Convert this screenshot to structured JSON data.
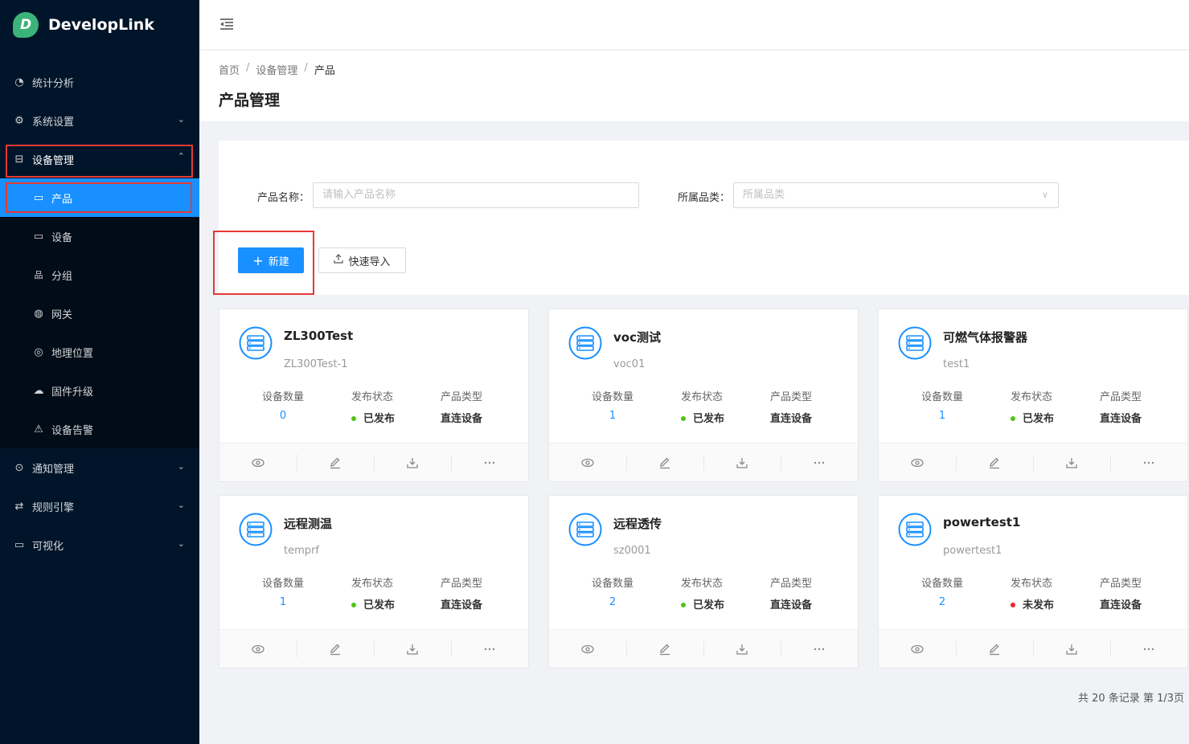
{
  "app": {
    "name": "DevelopLink",
    "logo_letter": "D"
  },
  "sidebar": {
    "items": [
      {
        "label": "统计分析",
        "icon": "dashboard-icon",
        "glyph": "◔"
      },
      {
        "label": "系统设置",
        "icon": "gear-icon",
        "glyph": "⚙"
      },
      {
        "label": "设备管理",
        "icon": "device-icon",
        "glyph": "⊟"
      },
      {
        "label": "通知管理",
        "icon": "message-icon",
        "glyph": "⊙"
      },
      {
        "label": "规则引擎",
        "icon": "swap-icon",
        "glyph": "⇄"
      },
      {
        "label": "可视化",
        "icon": "monitor-icon",
        "glyph": "▭"
      }
    ],
    "sub_items": [
      {
        "label": "产品",
        "icon": "laptop-icon",
        "glyph": "▭"
      },
      {
        "label": "设备",
        "icon": "desktop-icon",
        "glyph": "▭"
      },
      {
        "label": "分组",
        "icon": "cluster-icon",
        "glyph": "品"
      },
      {
        "label": "网关",
        "icon": "globe-icon",
        "glyph": "◍"
      },
      {
        "label": "地理位置",
        "icon": "compass-icon",
        "glyph": "◎"
      },
      {
        "label": "固件升级",
        "icon": "cloud-sync-icon",
        "glyph": "☁"
      },
      {
        "label": "设备告警",
        "icon": "alert-icon",
        "glyph": "⚠"
      }
    ]
  },
  "breadcrumb": [
    "首页",
    "设备管理",
    "产品"
  ],
  "breadcrumb_sep": "/",
  "page_title": "产品管理",
  "search": {
    "name_label": "产品名称：",
    "name_placeholder": "请输入产品名称",
    "category_label": "所属品类：",
    "category_placeholder": "所属品类"
  },
  "toolbar": {
    "new_label": "新建",
    "import_label": "快速导入"
  },
  "stat_labels": {
    "count": "设备数量",
    "status": "发布状态",
    "type": "产品类型"
  },
  "colors": {
    "primary": "#1890ff",
    "published": "#52c41a",
    "unpublished": "#f5222d",
    "highlight": "#e53935"
  },
  "products": [
    {
      "name": "ZL300Test",
      "code": "ZL300Test-1",
      "count": "0",
      "status": "已发布",
      "published": true,
      "type": "直连设备"
    },
    {
      "name": "voc测试",
      "code": "voc01",
      "count": "1",
      "status": "已发布",
      "published": true,
      "type": "直连设备"
    },
    {
      "name": "可燃气体报警器",
      "code": "test1",
      "count": "1",
      "status": "已发布",
      "published": true,
      "type": "直连设备"
    },
    {
      "name": "远程测温",
      "code": "temprf",
      "count": "1",
      "status": "已发布",
      "published": true,
      "type": "直连设备"
    },
    {
      "name": "远程透传",
      "code": "sz0001",
      "count": "2",
      "status": "已发布",
      "published": true,
      "type": "直连设备"
    },
    {
      "name": "powertest1",
      "code": "powertest1",
      "count": "2",
      "status": "未发布",
      "published": false,
      "type": "直连设备"
    }
  ],
  "card_actions": [
    "eye-icon",
    "edit-icon",
    "download-icon",
    "more-icon"
  ],
  "pagination": {
    "text": "共 20 条记录 第 1/3页"
  }
}
